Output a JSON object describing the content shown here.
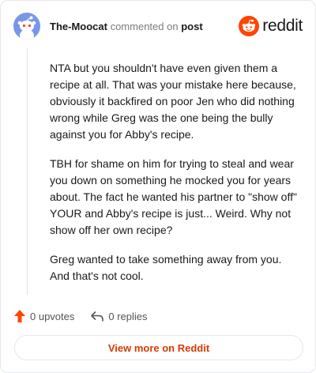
{
  "comment": {
    "author": "The-Moocat",
    "action_text": "commented on",
    "post_link": "post",
    "paragraphs": [
      "NTA but you shouldn't have even given them a recipe at all. That was your mistake here because, obviously it backfired on poor Jen who did nothing wrong while Greg was the one being the bully against you for Abby's recipe.",
      "TBH for shame on him for trying to steal and wear you down on something he mocked you for years about. The fact he wanted his partner to \"show off\" YOUR and Abby's recipe is just... Weird. Why not show off her own recipe?",
      "Greg wanted to take something away from you. And that's not cool."
    ]
  },
  "brand": {
    "name": "reddit",
    "icon": "reddit-snoo-icon",
    "color": "#ff4500"
  },
  "avatar": {
    "icon": "snoo-avatar-icon",
    "color": "#7a96e8"
  },
  "actions": {
    "upvotes": "0 upvotes",
    "upvote_icon": "upvote-arrow-icon",
    "upvote_color": "#ff4500",
    "replies": "0 replies",
    "reply_icon": "reply-arrow-icon"
  },
  "footer": {
    "view_more": "View more on Reddit",
    "accent": "#d93a00"
  }
}
